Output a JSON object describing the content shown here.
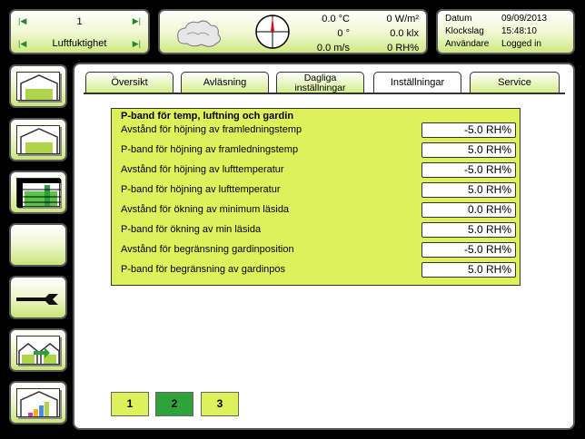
{
  "selector": {
    "number": "1",
    "label": "Luftfuktighet"
  },
  "weather": {
    "temperature": "0.0 °C",
    "radiation": "0 W/m²",
    "direction": "0 °",
    "light": "0.0 klx",
    "wind": "0.0 m/s",
    "humidity": "0 RH%"
  },
  "status": {
    "date_label": "Datum",
    "date_value": "09/09/2013",
    "time_label": "Klockslag",
    "time_value": "15:48:10",
    "user_label": "Användare",
    "user_value": "Logged in"
  },
  "tabs": [
    {
      "label": "Översikt"
    },
    {
      "label": "Avläsning"
    },
    {
      "label": "Dagliga\ninställningar"
    },
    {
      "label": "Inställningar"
    },
    {
      "label": "Service"
    }
  ],
  "settings": {
    "title": "P-band för temp, luftning och gardin",
    "rows": [
      {
        "label": "Avstånd för höjning av framledningstemp",
        "value": "-5.0 RH%"
      },
      {
        "label": "P-band för höjning av framledningstemp",
        "value": "5.0 RH%"
      },
      {
        "label": "Avstånd för höjning av lufttemperatur",
        "value": "-5.0 RH%"
      },
      {
        "label": "P-band för höjning av lufttemperatur",
        "value": "5.0 RH%"
      },
      {
        "label": "Avstånd för ökning av minimum läsida",
        "value": "0.0 RH%"
      },
      {
        "label": "P-band för ökning av min läsida",
        "value": "5.0 RH%"
      },
      {
        "label": "Avstånd för begränsning gardinposition",
        "value": "-5.0 RH%"
      },
      {
        "label": "P-band för begränsning av gardinpos",
        "value": "5.0 RH%"
      }
    ]
  },
  "pages": [
    {
      "label": "1"
    },
    {
      "label": "2"
    },
    {
      "label": "3"
    }
  ],
  "colors": {
    "panel_green": "#ddf25a",
    "active_green": "#2fa33a"
  }
}
